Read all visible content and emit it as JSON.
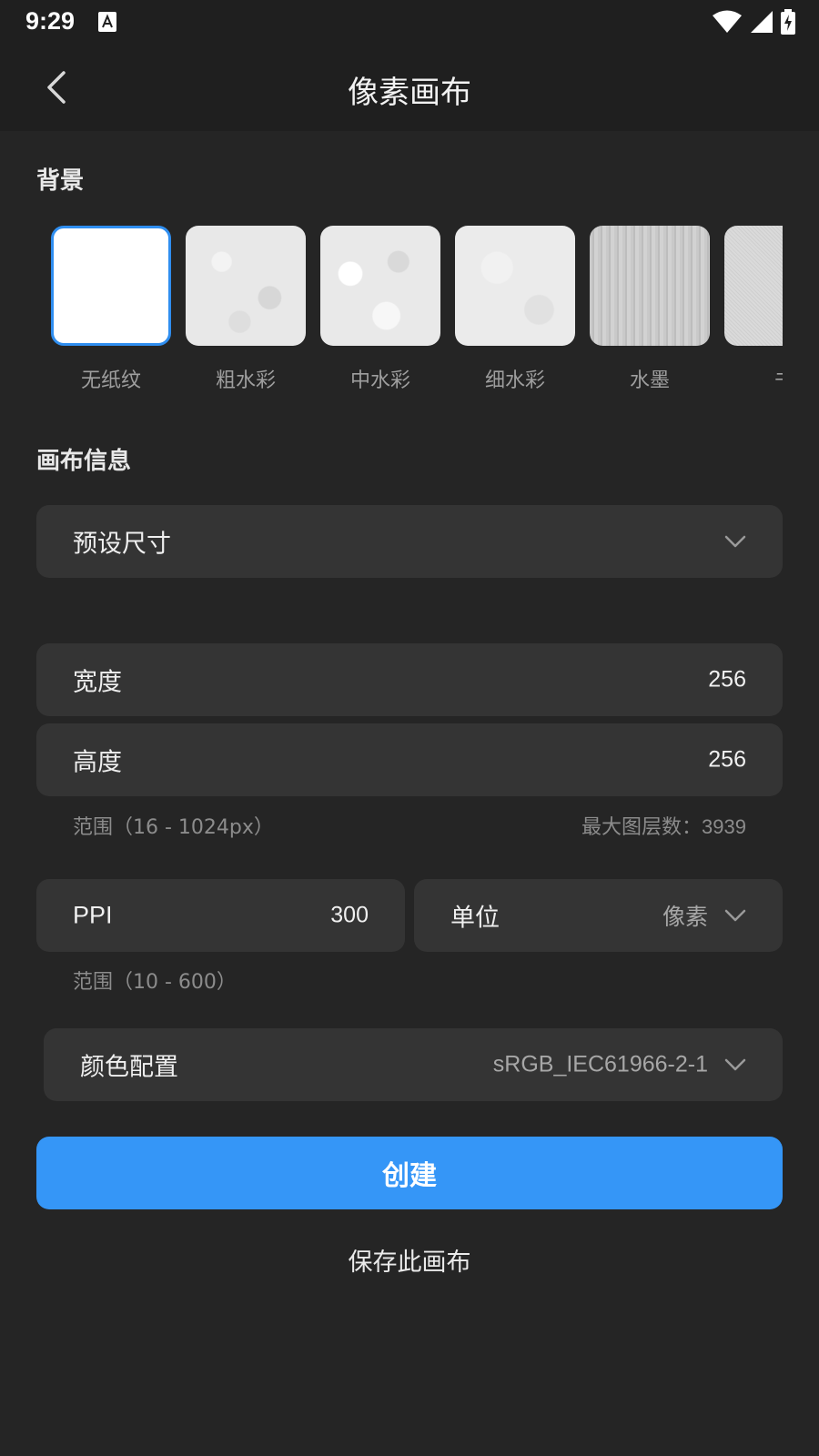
{
  "status_bar": {
    "time": "9:29",
    "notification_icon": "a-icon",
    "icons": [
      "wifi-icon",
      "signal-icon",
      "battery-charging-icon"
    ]
  },
  "app_bar": {
    "title": "像素画布",
    "back_icon": "chevron-left-icon"
  },
  "background_section": {
    "title": "背景",
    "textures": [
      {
        "label": "无纸纹",
        "selected": true
      },
      {
        "label": "粗水彩"
      },
      {
        "label": "中水彩"
      },
      {
        "label": "细水彩"
      },
      {
        "label": "水墨"
      },
      {
        "label": "书"
      }
    ]
  },
  "canvas_info": {
    "title": "画布信息",
    "preset": {
      "label": "预设尺寸"
    },
    "width": {
      "label": "宽度",
      "value": "256"
    },
    "height": {
      "label": "高度",
      "value": "256"
    },
    "size_range": "范围（16 - 1024px）",
    "max_layers": {
      "label": "最大图层数：",
      "value": "3939"
    },
    "ppi": {
      "label": "PPI",
      "value": "300"
    },
    "unit": {
      "label": "单位",
      "value": "像素"
    },
    "ppi_range": "范围（10 - 600）",
    "color_profile": {
      "label": "颜色配置",
      "value": "sRGB_IEC61966-2-1"
    }
  },
  "actions": {
    "create_label": "创建",
    "save_label": "保存此画布"
  },
  "colors": {
    "accent": "#3596f7",
    "background": "#252525",
    "card": "#343434",
    "bar": "#1f1f1f"
  }
}
